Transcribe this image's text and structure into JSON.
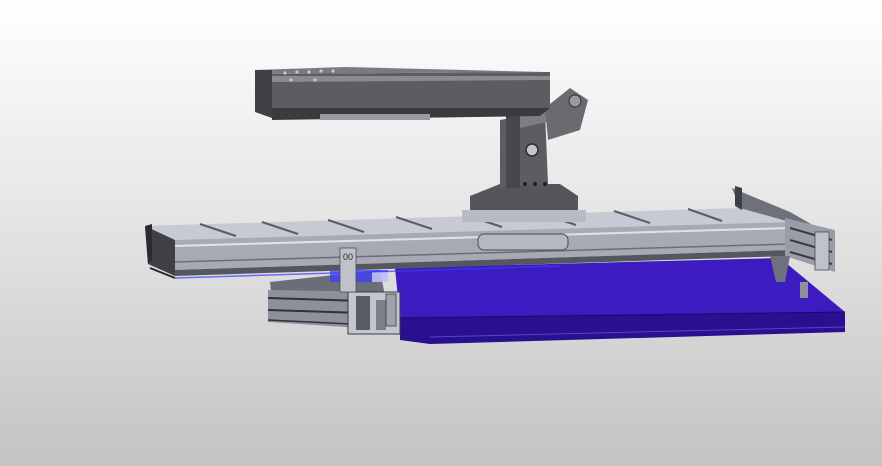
{
  "viewport": {
    "background_top": "#ffffff",
    "background_bottom": "#c3c3c3"
  },
  "model": {
    "part_tag": "00",
    "colors": {
      "frame_metal": "#a7a9b4",
      "frame_dark": "#3f4046",
      "arm": "#5c5d61",
      "plate": "#3c1bc0",
      "plate_dark": "#2a0f8e",
      "accent_blue": "#3c3cff"
    }
  }
}
